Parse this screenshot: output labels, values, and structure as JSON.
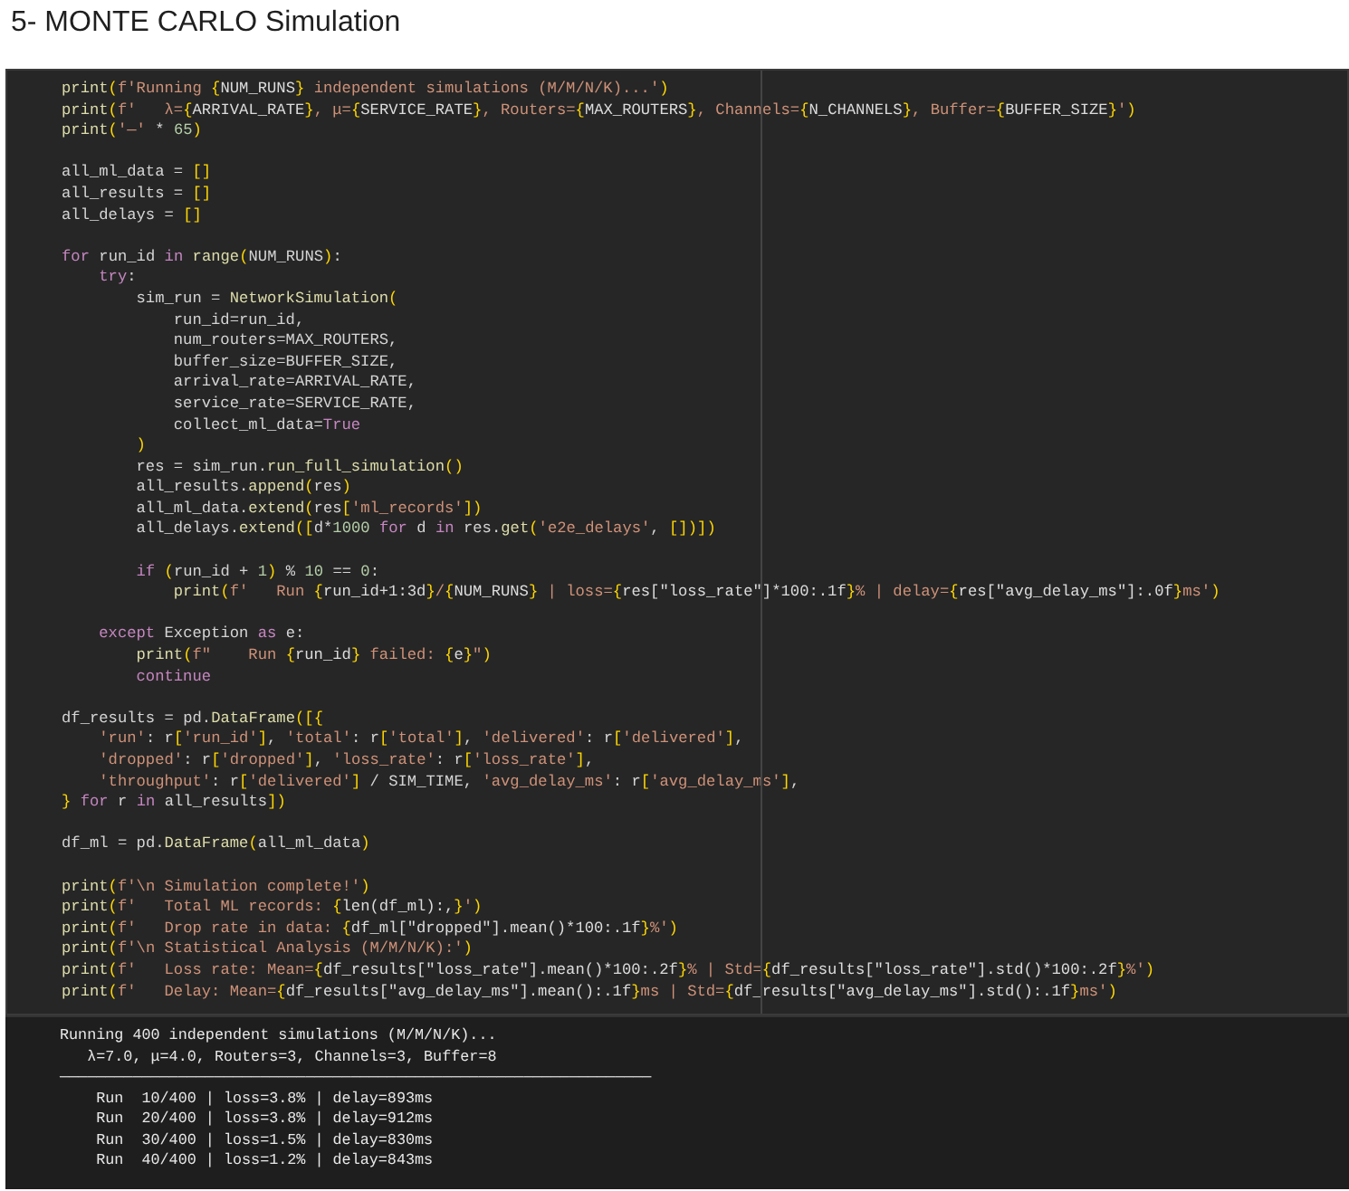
{
  "title": "5- MONTE CARLO Simulation",
  "code_blocks": [
    [
      "print(f'Running {NUM_RUNS} independent simulations (M/M/N/K)...')",
      "print(f'   λ={ARRIVAL_RATE}, μ={SERVICE_RATE}, Routers={MAX_ROUTERS}, Channels={N_CHANNELS}, Buffer={BUFFER_SIZE}')",
      "print('—' * 65)"
    ],
    [
      "all_ml_data = []",
      "all_results = []",
      "all_delays = []"
    ],
    [
      "for run_id in range(NUM_RUNS):",
      "    try:",
      "        sim_run = NetworkSimulation(",
      "            run_id=run_id,",
      "            num_routers=MAX_ROUTERS,",
      "            buffer_size=BUFFER_SIZE,",
      "            arrival_rate=ARRIVAL_RATE,",
      "            service_rate=SERVICE_RATE,",
      "            collect_ml_data=True",
      "        )",
      "        res = sim_run.run_full_simulation()",
      "        all_results.append(res)",
      "        all_ml_data.extend(res['ml_records'])",
      "        all_delays.extend([d*1000 for d in res.get('e2e_delays', [])])"
    ],
    [
      "        if (run_id + 1) % 10 == 0:",
      "            print(f'   Run {run_id+1:3d}/{NUM_RUNS} | loss={res[\"loss_rate\"]*100:.1f}% | delay={res[\"avg_delay_ms\"]:.0f}ms')"
    ],
    [
      "    except Exception as e:",
      "        print(f\"    Run {run_id} failed: {e}\")",
      "        continue"
    ],
    [
      "df_results = pd.DataFrame([{",
      "    'run': r['run_id'], 'total': r['total'], 'delivered': r['delivered'],",
      "    'dropped': r['dropped'], 'loss_rate': r['loss_rate'],",
      "    'throughput': r['delivered'] / SIM_TIME, 'avg_delay_ms': r['avg_delay_ms'],",
      "} for r in all_results])"
    ],
    [
      "df_ml = pd.DataFrame(all_ml_data)"
    ],
    [
      "print(f'\\n Simulation complete!')",
      "print(f'   Total ML records: {len(df_ml):,}')",
      "print(f'   Drop rate in data: {df_ml[\"dropped\"].mean()*100:.1f}%')",
      "print(f'\\n Statistical Analysis (M/M/N/K):')",
      "print(f'   Loss rate: Mean={df_results[\"loss_rate\"].mean()*100:.2f}% | Std={df_results[\"loss_rate\"].std()*100:.2f}%')",
      "print(f'   Delay: Mean={df_results[\"avg_delay_ms\"].mean():.1f}ms | Std={df_results[\"avg_delay_ms\"].std():.1f}ms')"
    ]
  ],
  "output_lines": [
    "Running 400 independent simulations (M/M/N/K)...",
    "   λ=7.0, μ=4.0, Routers=3, Channels=3, Buffer=8",
    "—————————————————————————————————————————————————————————————————",
    "    Run  10/400 | loss=3.8% | delay=893ms",
    "    Run  20/400 | loss=3.8% | delay=912ms",
    "    Run  30/400 | loss=1.5% | delay=830ms",
    "    Run  40/400 | loss=1.2% | delay=843ms"
  ]
}
